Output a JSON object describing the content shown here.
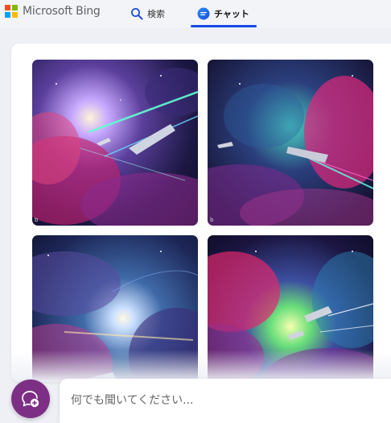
{
  "header": {
    "brand": "Microsoft Bing",
    "tabs": [
      {
        "label": "検索",
        "icon": "search-icon",
        "active": false
      },
      {
        "label": "チャット",
        "icon": "chat-icon",
        "active": true
      }
    ],
    "accent_color": "#174ae4"
  },
  "images": [
    {
      "subject": "spaceships-nebula-1"
    },
    {
      "subject": "spaceships-nebula-2"
    },
    {
      "subject": "spaceships-nebula-3"
    },
    {
      "subject": "spaceships-nebula-4"
    }
  ],
  "composer": {
    "placeholder": "何でも聞いてください...",
    "value": "",
    "new_topic_icon": "new-topic-icon",
    "new_topic_color": "#7c2f85"
  }
}
